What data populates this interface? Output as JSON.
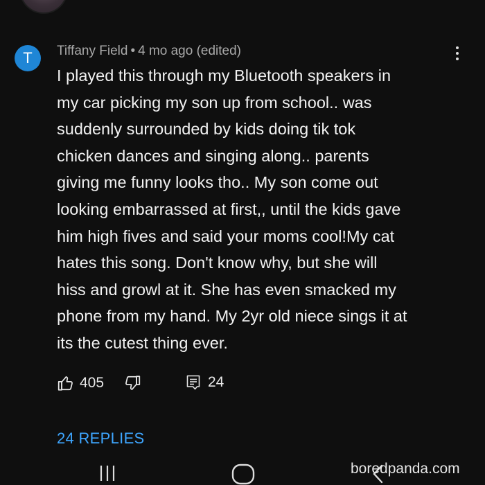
{
  "comment": {
    "avatar_letter": "T",
    "avatar_color": "#1f86d6",
    "author": "Tiffany Field",
    "separator": "•",
    "timestamp": "4 mo ago (edited)",
    "menu_icon": "more-vertical-icon",
    "body_lines": [
      "I played this through my Bluetooth speakers in",
      "my car picking my son up from school..  was",
      "suddenly surrounded by kids doing tik tok",
      "chicken dances and singing along.. parents",
      "giving me funny looks tho.. My son come out",
      "looking embarrassed at first,, until the kids gave",
      "him high fives and said your moms cool!My cat",
      "hates this song. Don't know why, but she will",
      "hiss and growl at it. She has even smacked my",
      "phone from my hand. My 2yr old niece sings it at",
      "its the cutest thing ever."
    ]
  },
  "actions": {
    "like_icon": "thumbs-up-icon",
    "like_count": "405",
    "dislike_icon": "thumbs-down-icon",
    "reply_icon": "comment-icon",
    "reply_count": "24"
  },
  "replies": {
    "label": "24 REPLIES",
    "color": "#3ea6ff"
  },
  "system_nav": {
    "recents_icon": "recents-icon",
    "home_icon": "home-icon",
    "back_icon": "back-icon"
  },
  "watermark": "boredpanda.com"
}
